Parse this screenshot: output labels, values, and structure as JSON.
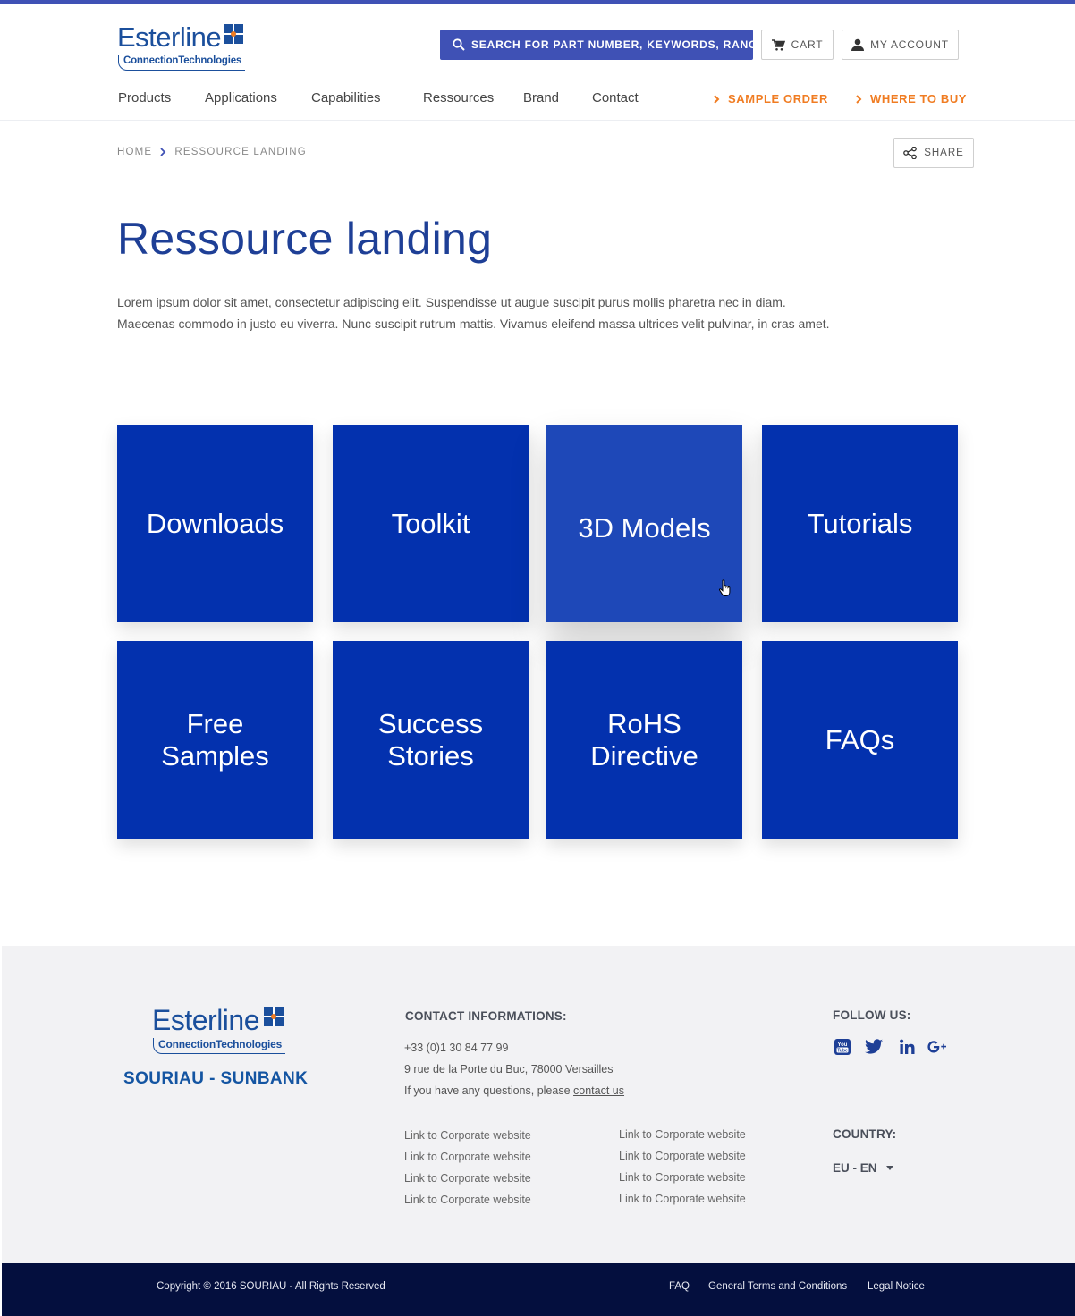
{
  "brand": {
    "logo_word": "Esterline",
    "logo_tagline": "ConnectionTechnologies",
    "footer_brand": "SOURIAU - SUNBANK",
    "accent": "#3f51b5",
    "tile_color": "#0331ae",
    "orange": "#f07c22"
  },
  "header": {
    "search_label": "SEARCH FOR PART NUMBER, KEYWORDS, RANGE",
    "cart_label": "CART",
    "account_label": "MY ACCOUNT",
    "icons": {
      "search": "search-icon",
      "cart": "cart-icon",
      "account": "user-icon"
    }
  },
  "nav": {
    "items": [
      "Products",
      "Applications",
      "Capabilities",
      "Ressources",
      "Brand",
      "Contact"
    ],
    "sample_order": "SAMPLE ORDER",
    "where_to_buy": "WHERE TO BUY"
  },
  "breadcrumb": {
    "home": "HOME",
    "current": "RESSOURCE LANDING"
  },
  "share_label": "SHARE",
  "page": {
    "title": "Ressource landing",
    "intro": "Lorem ipsum dolor sit amet, consectetur adipiscing elit. Suspendisse ut augue suscipit purus mollis pharetra nec in diam. Maecenas commodo in justo eu viverra. Nunc suscipit rutrum mattis. Vivamus eleifend massa ultrices velit pulvinar, in cras amet."
  },
  "tiles": [
    "Downloads",
    "Toolkit",
    "3D Models",
    "Tutorials",
    "Free Samples",
    "Success Stories",
    "RoHS Directive",
    "FAQs"
  ],
  "footer": {
    "contact_heading": "CONTACT INFORMATIONS:",
    "phone": "+33 (0)1 30 84 77 99",
    "address": "9 rue de la Porte du Buc, 78000 Versailles",
    "question_text": "If you have any questions, please",
    "contact_link": "contact us",
    "links_col1": [
      "Link to Corporate website",
      "Link to Corporate website",
      "Link to Corporate website",
      "Link to Corporate website"
    ],
    "links_col2": [
      "Link to Corporate website",
      "Link to Corporate website",
      "Link to Corporate website",
      "Link to Corporate website"
    ],
    "follow_heading": "FOLLOW US:",
    "social": [
      "youtube-icon",
      "twitter-icon",
      "linkedin-icon",
      "google-plus-icon"
    ],
    "country_heading": "COUNTRY:",
    "country_value": "EU - EN"
  },
  "bottom": {
    "copyright": "Copyright © 2016 SOURIAU - All Rights Reserved",
    "faq": "FAQ",
    "terms": "General Terms and Conditions",
    "legal": "Legal Notice"
  }
}
